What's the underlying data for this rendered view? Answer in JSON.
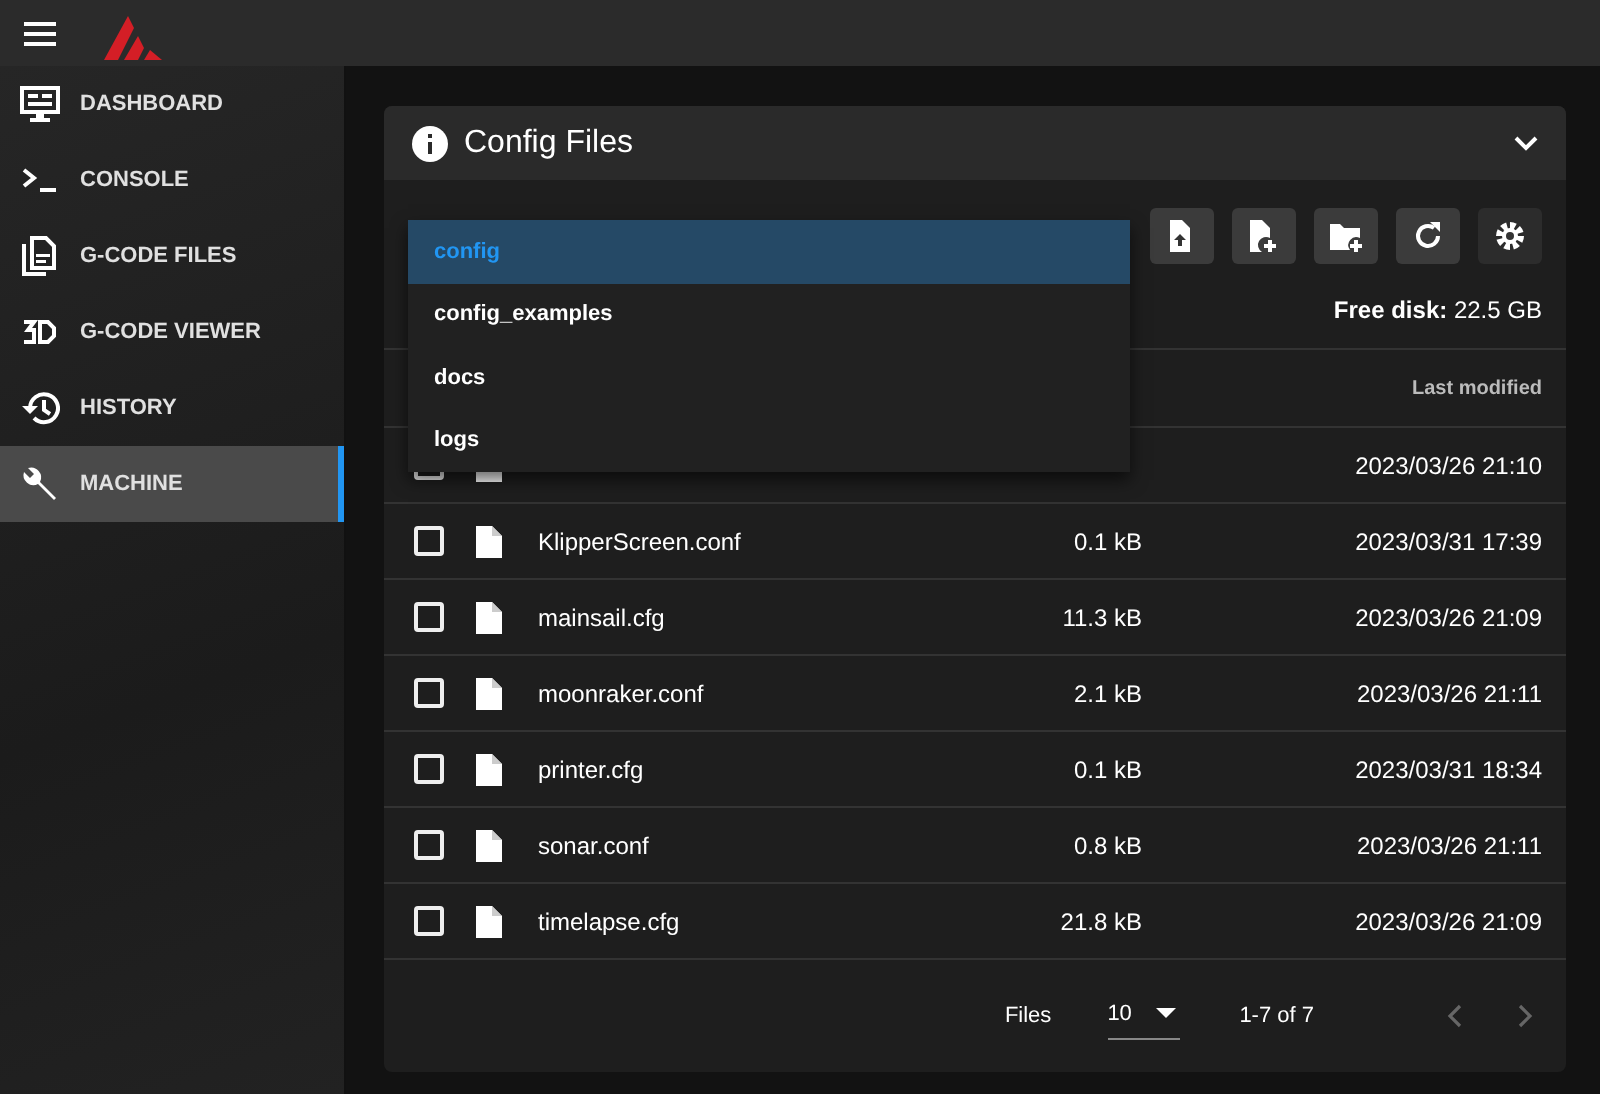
{
  "nav": [
    {
      "label": "DASHBOARD",
      "selected": false
    },
    {
      "label": "CONSOLE",
      "selected": false
    },
    {
      "label": "G-CODE FILES",
      "selected": false
    },
    {
      "label": "G-CODE VIEWER",
      "selected": false
    },
    {
      "label": "HISTORY",
      "selected": false
    },
    {
      "label": "MACHINE",
      "selected": true
    }
  ],
  "panel": {
    "title": "Config Files",
    "free_disk_label": "Free disk:",
    "free_disk": "22.5 GB",
    "root_menu": [
      {
        "label": "config",
        "selected": true
      },
      {
        "label": "config_examples",
        "selected": false
      },
      {
        "label": "docs",
        "selected": false
      },
      {
        "label": "logs",
        "selected": false
      }
    ],
    "columns": {
      "modified": "Last modified"
    },
    "rows": [
      {
        "modified": "2023/03/26 21:10",
        "checked": false
      },
      {
        "name": "KlipperScreen.conf",
        "size": "0.1 kB",
        "modified": "2023/03/31 17:39",
        "checked": false
      },
      {
        "name": "mainsail.cfg",
        "size": "11.3 kB",
        "modified": "2023/03/26 21:09",
        "checked": false
      },
      {
        "name": "moonraker.conf",
        "size": "2.1 kB",
        "modified": "2023/03/26 21:11",
        "checked": false
      },
      {
        "name": "printer.cfg",
        "size": "0.1 kB",
        "modified": "2023/03/31 18:34",
        "checked": false
      },
      {
        "name": "sonar.conf",
        "size": "0.8 kB",
        "modified": "2023/03/26 21:11",
        "checked": false
      },
      {
        "name": "timelapse.cfg",
        "size": "21.8 kB",
        "modified": "2023/03/26 21:09",
        "checked": false
      }
    ],
    "footer": {
      "label": "Files",
      "per_page": "10",
      "range": "1-7 of 7"
    }
  }
}
